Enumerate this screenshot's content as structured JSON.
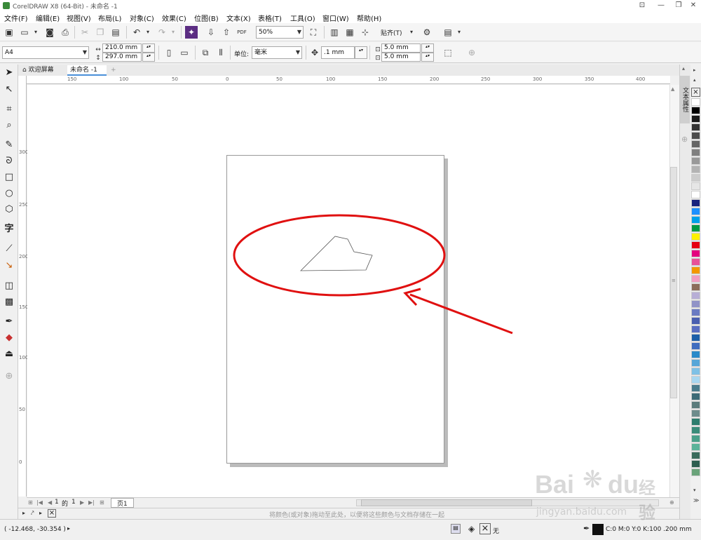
{
  "window": {
    "title": "CorelDRAW X8 (64-Bit) - 未命名 -1",
    "buttons": [
      "⊡",
      "—",
      "❐",
      "✕"
    ]
  },
  "menu": [
    "文件(F)",
    "编辑(E)",
    "视图(V)",
    "布局(L)",
    "对象(C)",
    "效果(C)",
    "位图(B)",
    "文本(X)",
    "表格(T)",
    "工具(O)",
    "窗口(W)",
    "帮助(H)"
  ],
  "toolbar": {
    "pdf_label": "PDF",
    "zoom": "50%",
    "snap": "贴齐(T)"
  },
  "propbar": {
    "page_size": "A4",
    "width": "210.0 mm",
    "height": "297.0 mm",
    "unit_label": "单位:",
    "unit": "毫米",
    "nudge": ".1 mm",
    "dup_x": "5.0 mm",
    "dup_y": "5.0 mm"
  },
  "tabs": {
    "welcome": "欢迎屏幕",
    "document": "未命名 -1"
  },
  "ruler_top": [
    "150",
    "100",
    "50",
    "0",
    "50",
    "100",
    "150",
    "200",
    "250",
    "300",
    "350",
    "400"
  ],
  "ruler_left": [
    "300",
    "250",
    "200",
    "150",
    "100",
    "50",
    "0"
  ],
  "docker": {
    "tab_label": "文本属性"
  },
  "pages": {
    "current": "1",
    "of_label": "的",
    "total": "1",
    "page_tab": "页1"
  },
  "palette_hint": "将颜色(或对象)拖动至此处，以便将这些颜色与文档存储在一起",
  "status": {
    "coords": "( -12.468, -30.354 )",
    "fill_none": "无",
    "outline": "C:0 M:0 Y:0 K:100  .200 mm"
  },
  "watermark": {
    "brand": "Bai",
    "brand2": "du",
    "cn": "经验",
    "url": "jingyan.baidu.com"
  },
  "colors": {
    "annotation": "#e01010",
    "palette": [
      "#ffffff",
      "#000000",
      "#1a1a1a",
      "#333333",
      "#4d4d4d",
      "#666666",
      "#808080",
      "#999999",
      "#b3b3b3",
      "#cccccc",
      "#e6e6e6",
      "#ffffff",
      "#1a237e",
      "#1e90ff",
      "#00a0e9",
      "#009944",
      "#fff100",
      "#e60012",
      "#e4007f",
      "#e85298",
      "#f39800",
      "#f19ec2",
      "#8c6d5a",
      "#b7aed6",
      "#9193c7",
      "#6b7bc2",
      "#4a5fb0",
      "#5a6ec2",
      "#1d5fa8",
      "#3f6dbf",
      "#2a8ac9",
      "#56a6d8",
      "#7fc1e6",
      "#a9d7f0",
      "#4a7c8c",
      "#3d6b77",
      "#5b7c7c",
      "#6e8c8c",
      "#2e7d6e",
      "#3b8c7a",
      "#4aa08a",
      "#5cb39a",
      "#3a6b5c",
      "#2e5e50",
      "#6aa37a"
    ]
  }
}
